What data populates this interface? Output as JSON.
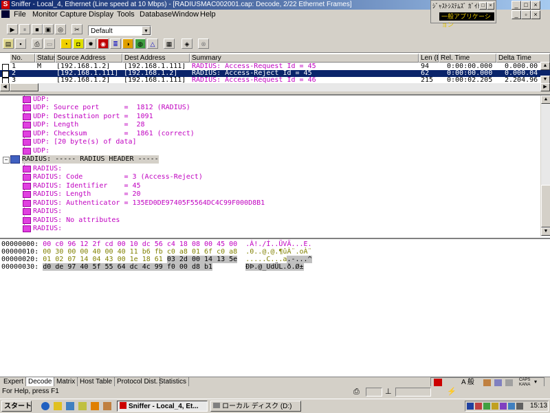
{
  "window": {
    "title": "Sniffer - Local_4, Ethernet (Line speed at 10 Mbps) - [RADIUSMAC002001.cap: Decode, 2/22 Ethernet Frames]",
    "app_icon_letter": "S"
  },
  "ime_widget": {
    "line1": "ｼﾞｬｽﾄｼｽﾃﾑｽﾞ ｶﾞｲﾄﾞ",
    "line2": "一般アプリケーション"
  },
  "menu": [
    "File",
    "Monitor",
    "Capture",
    "Display",
    "Tools",
    "Database",
    "Window",
    "Help"
  ],
  "toolbar": {
    "profile_value": "Default"
  },
  "packet_list": {
    "headers": [
      "No.",
      "Status",
      "Source Address",
      "Dest Address",
      "Summary",
      "Len (B",
      "Rel. Time",
      "Delta Time"
    ],
    "rows": [
      {
        "no": "1",
        "status": "M",
        "src": "[192.168.1.2]",
        "dst": "[192.168.1.111]",
        "summary": "RADIUS: Access-Request Id = 45",
        "len": "94",
        "rel": "0:00:00.000",
        "delta": "0.000.00"
      },
      {
        "no": "2",
        "status": "",
        "src": "[192.168.1.111]",
        "dst": "[192.168.1.2]",
        "summary": "RADIUS: Access-Reject Id = 45",
        "len": "62",
        "rel": "0:00:00.000",
        "delta": "0.000.04"
      },
      {
        "no": "3",
        "status": "",
        "src": "[192.168.1.2]",
        "dst": "[192.168.1.111]",
        "summary": "RADIUS: Access-Request Id = 46",
        "len": "215",
        "rel": "0:00:02.205",
        "delta": "2.204.96"
      }
    ]
  },
  "decode": {
    "udp_lines": [
      "UDP:",
      "UDP: Source port      =  1812 (RADIUS)",
      "UDP: Destination port =  1091",
      "UDP: Length           =  28",
      "UDP: Checksum         =  1861 (correct)",
      "UDP: [20 byte(s) of data]",
      "UDP:"
    ],
    "radius_header": "RADIUS: ----- RADIUS HEADER -----",
    "radius_lines": [
      "RADIUS:",
      "RADIUS: Code          = 3 (Access-Reject)",
      "RADIUS: Identifier    = 45",
      "RADIUS: Length        = 20",
      "RADIUS: Authenticator = 135ED0DE97405F5564DC4C99F000D8B1",
      "RADIUS:",
      "RADIUS: No attributes",
      "RADIUS:"
    ]
  },
  "hex": [
    {
      "offset": "00000000:",
      "bytes": "00 c0 96 12 2f cd 00 10 dc 56 c4 18 08 00 45 00",
      "ascii": ".À!./Í..ÜVÄ...E."
    },
    {
      "offset": "00000010:",
      "bytes": "00 30 00 00 40 00 40 11 b6 fb c0 a8 01 6f c0 a8",
      "ascii": ".0..@.@.¶ûÀ¨.oÀ¨"
    },
    {
      "offset": "00000020:",
      "bytes_plain": "01 02 07 14 04 43 00 1e 18 61 ",
      "bytes_hl": "03 2d 00 14 13 5e",
      "ascii_plain": ".....C...a",
      "ascii_hl": ".-...^"
    },
    {
      "offset": "00000030:",
      "bytes_hl": "d0 de 97 40 5f 55 64 dc 4c 99 f0 00 d8 b1",
      "ascii_hl": "ÐÞ.@_UdÜL.ð.Ø±"
    }
  ],
  "tabs": [
    "Expert",
    "Decode",
    "Matrix",
    "Host Table",
    "Protocol Dist.",
    "Statistics"
  ],
  "active_tab": "Decode",
  "status_text": "For Help, press F1",
  "taskbar": {
    "start": "スタート",
    "tasks": [
      "Sniffer - Local_4, Et...",
      "ローカル ディスク (D:)"
    ],
    "clock": "15:13"
  },
  "tray": {
    "ime_mode": "A 般",
    "caps": "CAPS",
    "kana": "KANA"
  },
  "colors": {
    "title_gradient_start": "#0a246a",
    "selection": "#0a246a",
    "decode_text": "#c000c0",
    "hex_olive": "#808000",
    "hex_purple": "#c000c0"
  }
}
